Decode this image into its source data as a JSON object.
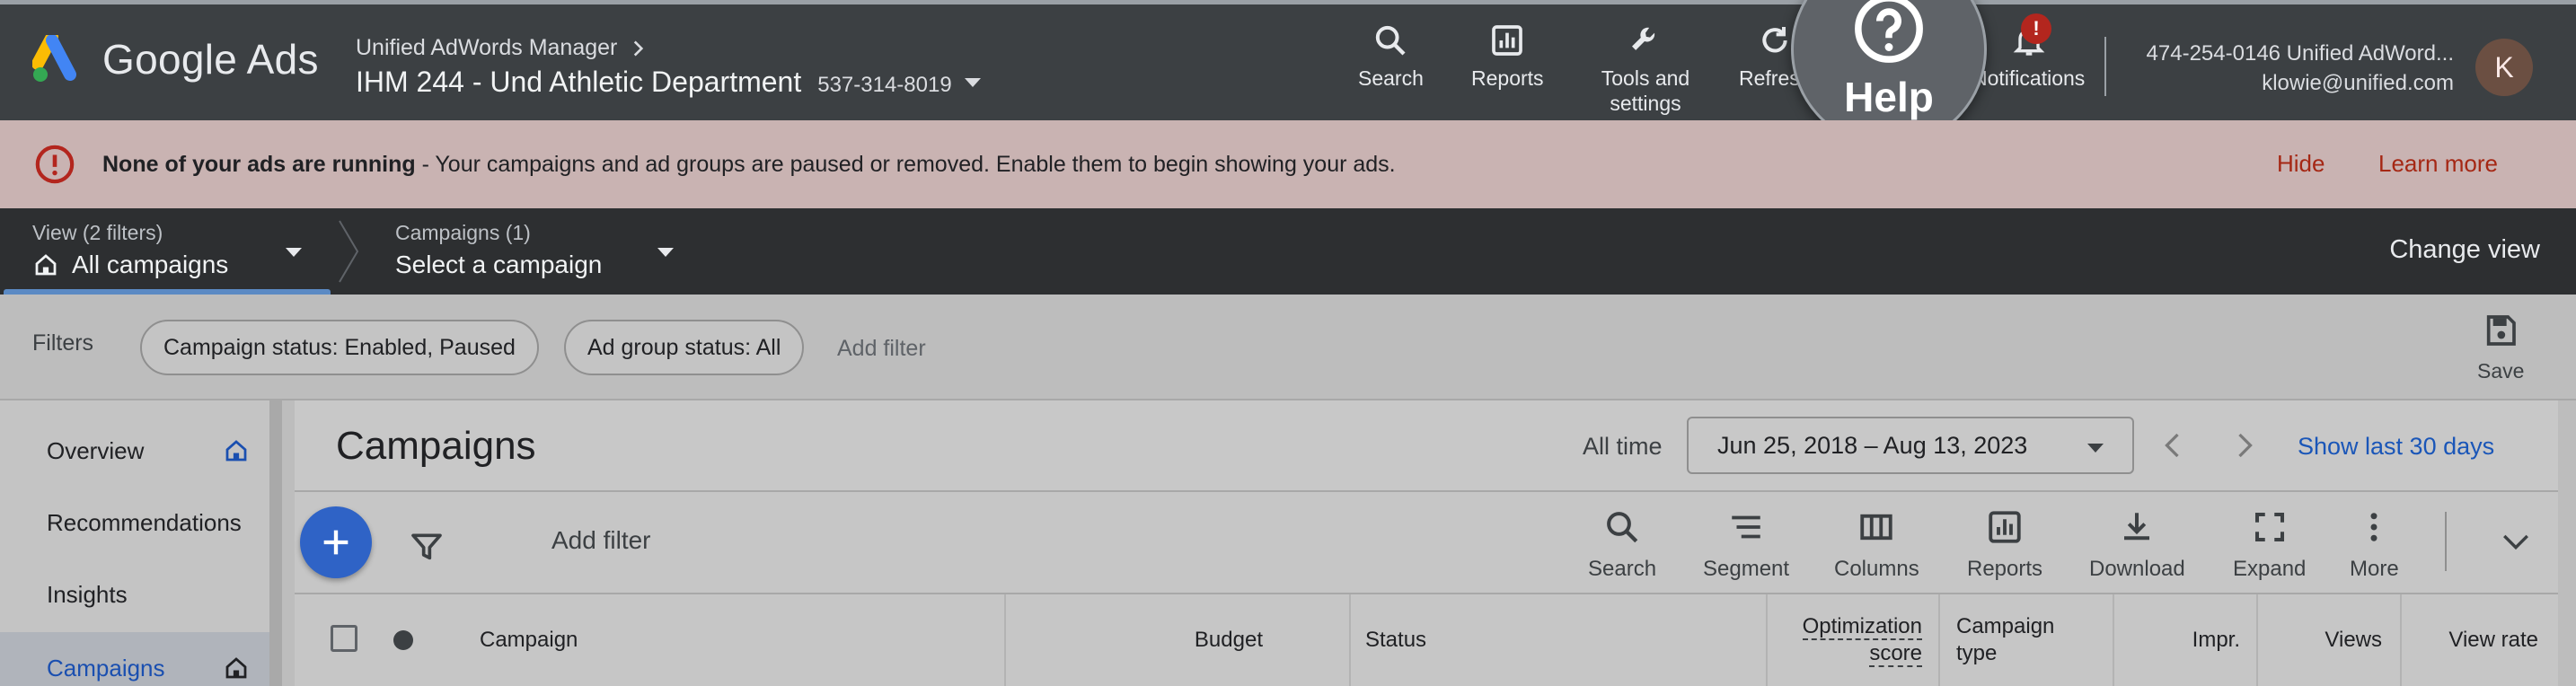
{
  "header": {
    "brand": "Google Ads",
    "account_parent": "Unified AdWords Manager",
    "account_name": "IHM 244 - Und Athletic Department",
    "account_id": "537-314-8019",
    "nav": [
      {
        "label": "Search",
        "icon": "search-icon"
      },
      {
        "label": "Reports",
        "icon": "reports-icon"
      },
      {
        "label": "Tools and settings",
        "icon": "wrench-icon"
      },
      {
        "label": "Refresh",
        "icon": "refresh-icon"
      },
      {
        "label": "Notifications",
        "icon": "bell-icon"
      }
    ],
    "notification_badge": "!",
    "user_line1": "474-254-0146 Unified AdWord...",
    "user_line2": "klowie@unified.com",
    "avatar_letter": "K",
    "help_label": "Help"
  },
  "alert": {
    "bold": "None of your ads are running",
    "text": " - Your campaigns and ad groups are paused or removed. Enable them to begin showing your ads.",
    "hide": "Hide",
    "learn_more": "Learn more"
  },
  "viewbar": {
    "view_label": "View (2 filters)",
    "view_value": "All campaigns",
    "campaigns_label": "Campaigns (1)",
    "campaigns_value": "Select a campaign",
    "change_view": "Change view"
  },
  "filters": {
    "label": "Filters",
    "chips": [
      "Campaign status: Enabled, Paused",
      "Ad group status: All"
    ],
    "add_filter": "Add filter",
    "save": "Save"
  },
  "sidebar": {
    "items": [
      {
        "label": "Overview"
      },
      {
        "label": "Recommendations"
      },
      {
        "label": "Insights"
      },
      {
        "label": "Campaigns"
      }
    ]
  },
  "main": {
    "title": "Campaigns",
    "all_time": "All time",
    "date_range": "Jun 25, 2018 – Aug 13, 2023",
    "show_last": "Show last 30 days",
    "add_filter": "Add filter",
    "tools": [
      "Search",
      "Segment",
      "Columns",
      "Reports",
      "Download",
      "Expand",
      "More"
    ],
    "columns": {
      "campaign": "Campaign",
      "budget": "Budget",
      "status": "Status",
      "opt_score_1": "Optimization",
      "opt_score_2": "score",
      "campaign_type_1": "Campaign",
      "campaign_type_2": "type",
      "impr": "Impr.",
      "views": "Views",
      "view_rate": "View rate"
    }
  },
  "colors": {
    "header_bg": "#3c4043",
    "alert_text": "#a52714",
    "link_blue": "#1a56b8",
    "fab_blue": "#2f63c6"
  }
}
